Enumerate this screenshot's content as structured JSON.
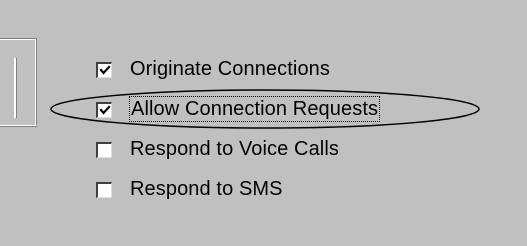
{
  "options": [
    {
      "label": "Originate Connections",
      "checked": true
    },
    {
      "label": "Allow Connection Requests",
      "checked": true,
      "focused": true
    },
    {
      "label": "Respond to Voice Calls",
      "checked": false
    },
    {
      "label": "Respond to SMS",
      "checked": false
    }
  ]
}
